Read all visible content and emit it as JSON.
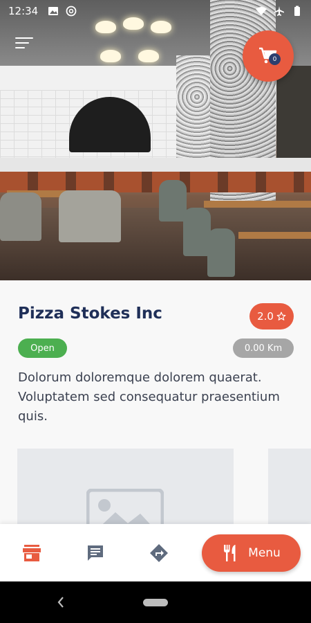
{
  "status_bar": {
    "time": "12:34",
    "icons_left": [
      "image-icon",
      "at-sign-icon"
    ],
    "icons_right": [
      "wifi-icon",
      "airplane-icon",
      "battery-icon"
    ]
  },
  "header": {
    "cart_count": "0",
    "icons": [
      "menu-icon",
      "cart-icon"
    ]
  },
  "restaurant": {
    "name": "Pizza Stokes Inc",
    "rating": "2.0",
    "status": "Open",
    "distance": "0.00 Km",
    "description": "Dolorum doloremque dolorem quaerat. Voluptatem sed consequatur praesentium quis."
  },
  "bottom_nav": {
    "menu_label": "Menu",
    "icons": [
      "store-icon",
      "chat-icon",
      "directions-icon",
      "fork-knife-icon"
    ]
  },
  "colors": {
    "accent": "#e85b40",
    "title": "#1f2f58",
    "open": "#4caf50",
    "distance": "#a6a6a6"
  }
}
